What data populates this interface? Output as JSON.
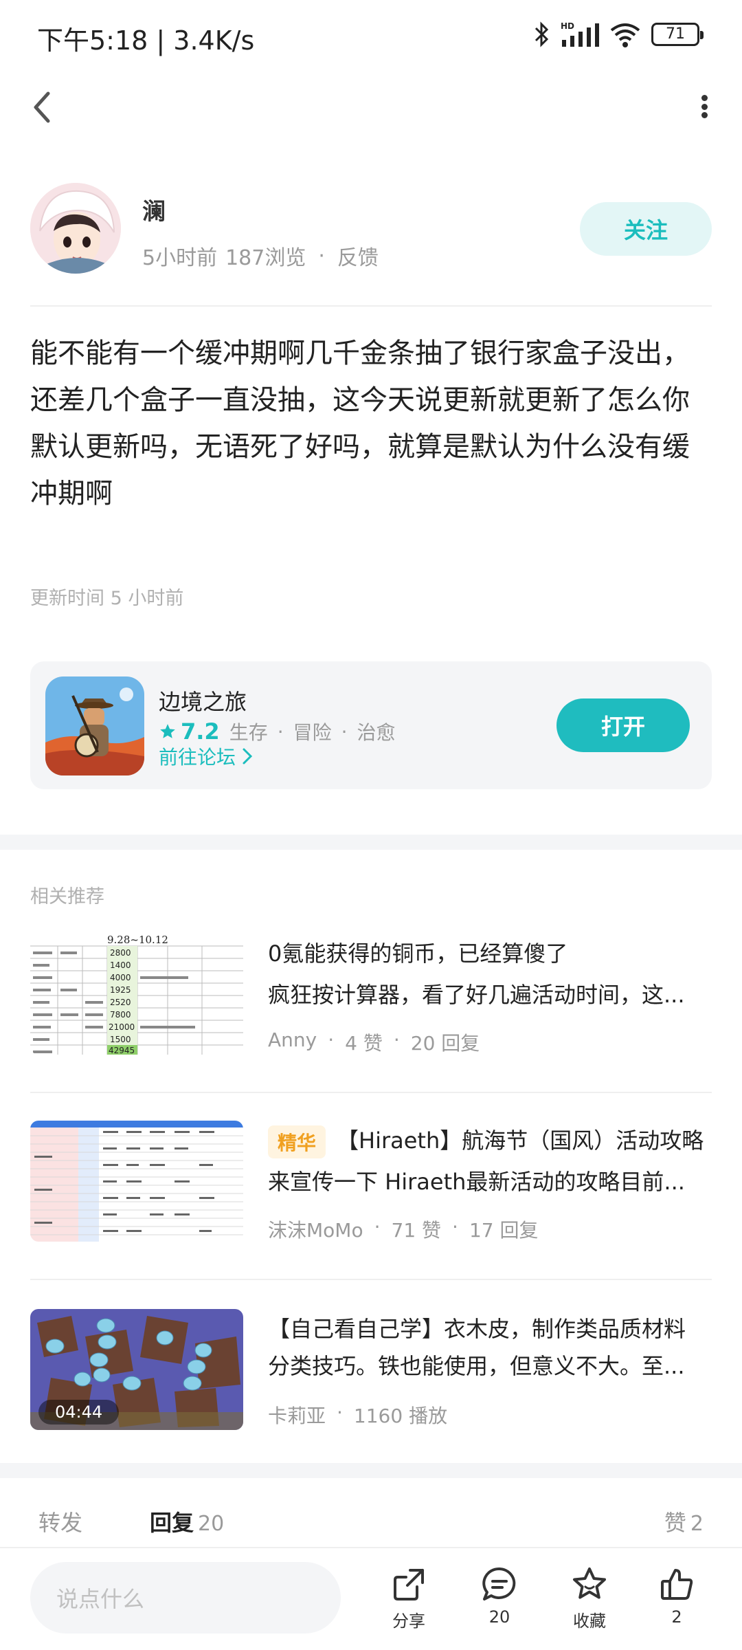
{
  "status_bar": {
    "time": "下午5:18 | 3.4K/s",
    "battery": "71"
  },
  "author": {
    "name": "澜",
    "time_ago": "5小时前",
    "views": "187浏览",
    "feedback": "反馈",
    "follow_label": "关注"
  },
  "post": {
    "body": "能不能有一个缓冲期啊几千金条抽了银行家盒子没出，还差几个盒子一直没抽，这今天说更新就更新了怎么你默认更新吗，无语死了好吗，就算是默认为什么没有缓冲期啊",
    "update_time": "更新时间 5 小时前"
  },
  "game": {
    "name": "边境之旅",
    "score": "7.2",
    "tags": [
      "生存",
      "冒险",
      "治愈"
    ],
    "forum_link": "前往论坛",
    "open_label": "打开"
  },
  "related": {
    "title": "相关推荐",
    "items": [
      {
        "title": "0氪能获得的铜币，已经算傻了",
        "subtitle": "疯狂按计算器，看了好几遍活动时间，这...",
        "author": "Anny",
        "likes": "4 赞",
        "replies": "20 回复",
        "thumb_header": "9.28~10.12",
        "thumb_values": [
          "2800",
          "1400",
          "4000",
          "1925",
          "2520",
          "7800",
          "21000",
          "1500",
          "42945"
        ]
      },
      {
        "badge": "精华",
        "title": "【Hiraeth】航海节（国风）活动攻略",
        "subtitle": "来宣传一下 Hiraeth最新活动的攻略目前...",
        "author": "沫沫MoMo",
        "likes": "71 赞",
        "replies": "17 回复"
      },
      {
        "title": "【自己看自己学】衣木皮，制作类品质材料",
        "subtitle": "分类技巧。铁也能使用，但意义不大。至...",
        "author": "卡莉亚",
        "plays": "1160 播放",
        "duration": "04:44"
      }
    ]
  },
  "tabs": {
    "forward": "转发",
    "reply": "回复",
    "reply_count": "20",
    "like": "赞",
    "like_count": "2"
  },
  "bottom_bar": {
    "input_placeholder": "说点什么",
    "share": "分享",
    "comment_count": "20",
    "favorite": "收藏",
    "like_count": "2"
  },
  "colors": {
    "accent": "#1fbcbf",
    "badge": "#f0a020"
  }
}
